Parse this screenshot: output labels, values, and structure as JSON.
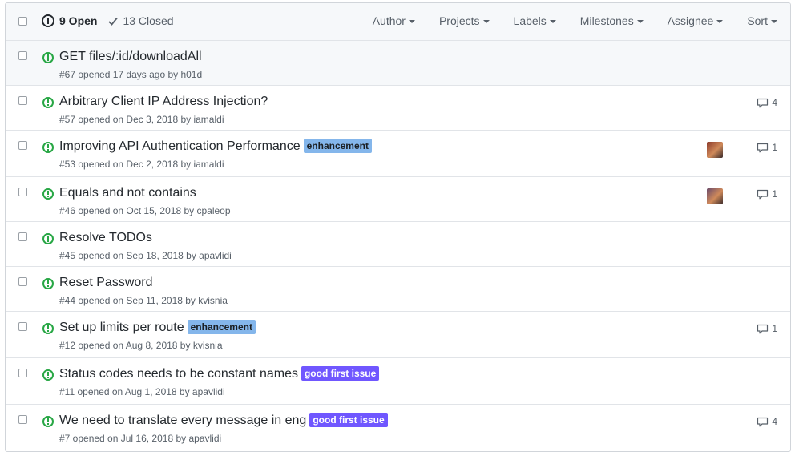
{
  "header": {
    "open_label": "9 Open",
    "closed_label": "13 Closed",
    "filters": [
      "Author",
      "Projects",
      "Labels",
      "Milestones",
      "Assignee",
      "Sort"
    ]
  },
  "colors": {
    "open_green": "#28a745",
    "enhancement": "#84b6eb",
    "good_first_issue": "#7057ff"
  },
  "issues": [
    {
      "title": "GET files/:id/downloadAll",
      "meta": "#67 opened 17 days ago by h01d",
      "labels": [],
      "comments": "",
      "avatar": false
    },
    {
      "title": "Arbitrary Client IP Address Injection?",
      "meta": "#57 opened on Dec 3, 2018 by iamaldi",
      "labels": [],
      "comments": "4",
      "avatar": false
    },
    {
      "title": "Improving API Authentication Performance",
      "meta": "#53 opened on Dec 2, 2018 by iamaldi",
      "labels": [
        {
          "text": "enhancement",
          "color": "#84b6eb",
          "text_color": "#1b1f23"
        }
      ],
      "comments": "1",
      "avatar": true,
      "avatar_color": "#8b3a2a"
    },
    {
      "title": "Equals and not contains",
      "meta": "#46 opened on Oct 15, 2018 by cpaleop",
      "labels": [],
      "comments": "1",
      "avatar": true,
      "avatar_color": "#6a4a6a"
    },
    {
      "title": "Resolve TODOs",
      "meta": "#45 opened on Sep 18, 2018 by apavlidi",
      "labels": [],
      "comments": "",
      "avatar": false
    },
    {
      "title": "Reset Password",
      "meta": "#44 opened on Sep 11, 2018 by kvisnia",
      "labels": [],
      "comments": "",
      "avatar": false
    },
    {
      "title": "Set up limits per route",
      "meta": "#12 opened on Aug 8, 2018 by kvisnia",
      "labels": [
        {
          "text": "enhancement",
          "color": "#84b6eb",
          "text_color": "#1b1f23"
        }
      ],
      "comments": "1",
      "avatar": false
    },
    {
      "title": "Status codes needs to be constant names",
      "meta": "#11 opened on Aug 1, 2018 by apavlidi",
      "labels": [
        {
          "text": "good first issue",
          "color": "#7057ff",
          "text_color": "#ffffff"
        }
      ],
      "comments": "",
      "avatar": false
    },
    {
      "title": "We need to translate every message in eng",
      "meta": "#7 opened on Jul 16, 2018 by apavlidi",
      "labels": [
        {
          "text": "good first issue",
          "color": "#7057ff",
          "text_color": "#ffffff"
        }
      ],
      "comments": "4",
      "avatar": false
    }
  ]
}
